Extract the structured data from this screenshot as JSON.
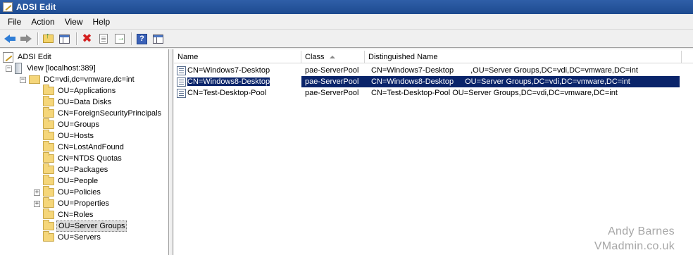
{
  "window": {
    "title": "ADSI Edit"
  },
  "menu": {
    "items": [
      {
        "label": "File"
      },
      {
        "label": "Action"
      },
      {
        "label": "View"
      },
      {
        "label": "Help"
      }
    ]
  },
  "toolbar": {
    "icons": [
      "back-arrow-icon",
      "forward-arrow-icon",
      "up-folder-icon",
      "show-hide-pane-icon",
      "delete-icon",
      "properties-icon",
      "export-list-icon",
      "help-icon",
      "action-pane-icon"
    ]
  },
  "tree": {
    "root": "ADSI Edit",
    "connection": "View [localhost:389]",
    "domain": "DC=vdi,dc=vmware,dc=int",
    "expander_plus": "+",
    "expander_minus": "−",
    "items": [
      {
        "label": "OU=Applications"
      },
      {
        "label": "OU=Data Disks"
      },
      {
        "label": "CN=ForeignSecurityPrincipals"
      },
      {
        "label": "OU=Groups"
      },
      {
        "label": "OU=Hosts"
      },
      {
        "label": "CN=LostAndFound"
      },
      {
        "label": "CN=NTDS Quotas"
      },
      {
        "label": "OU=Packages"
      },
      {
        "label": "OU=People"
      },
      {
        "label": "OU=Policies",
        "expandable": true
      },
      {
        "label": "OU=Properties",
        "expandable": true
      },
      {
        "label": "CN=Roles"
      },
      {
        "label": "OU=Server Groups",
        "selected": true
      },
      {
        "label": "OU=Servers"
      }
    ]
  },
  "list": {
    "columns": [
      {
        "label": "Name"
      },
      {
        "label": "Class",
        "sorted": "ascending"
      },
      {
        "label": "Distinguished Name"
      }
    ],
    "rows": [
      {
        "name": "CN=Windows7-Desktop",
        "class": "pae-ServerPool",
        "dn_cn": "CN=Windows7-Desktop",
        "dn_rest": ",OU=Server Groups,DC=vdi,DC=vmware,DC=int"
      },
      {
        "name": "CN=Windows8-Desktop",
        "class": "pae-ServerPool",
        "dn_cn": "CN=Windows8-Desktop",
        "dn_rest": "OU=Server Groups,DC=vdi,DC=vmware,DC=int",
        "selected": true
      },
      {
        "name": "CN=Test-Desktop-Pool",
        "class": "pae-ServerPool",
        "dn_cn": "CN=Test-Desktop-Pool",
        "dn_rest": "OU=Server Groups,DC=vdi,DC=vmware,DC=int"
      }
    ]
  },
  "watermark": {
    "line1": "Andy Barnes",
    "line2": "VMadmin.co.uk"
  }
}
